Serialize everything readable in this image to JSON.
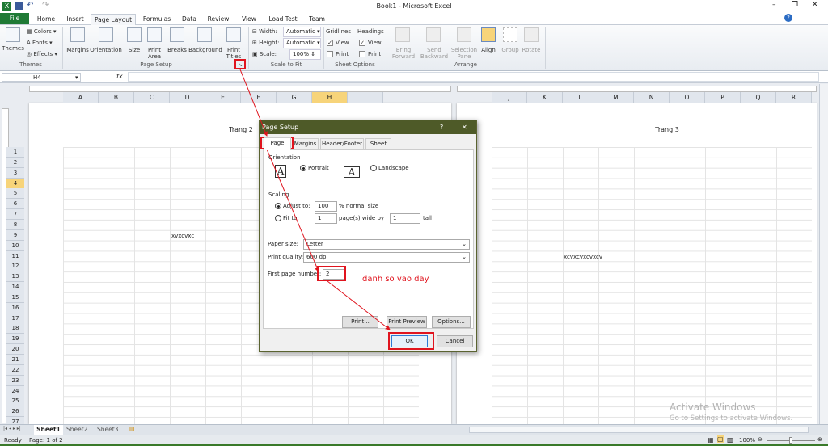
{
  "window": {
    "title": "Book1 - Microsoft Excel"
  },
  "ribbon_tabs": [
    "File",
    "Home",
    "Insert",
    "Page Layout",
    "Formulas",
    "Data",
    "Review",
    "View",
    "Load Test",
    "Team"
  ],
  "active_tab": "Page Layout",
  "ribbon": {
    "themes": {
      "themes": "Themes",
      "colors": "Colors",
      "fonts": "Fonts",
      "effects": "Effects",
      "group": "Themes"
    },
    "page_setup": {
      "margins": "Margins",
      "orientation": "Orientation",
      "size": "Size",
      "print_area_1": "Print",
      "print_area_2": "Area",
      "breaks": "Breaks",
      "background": "Background",
      "print_titles_1": "Print",
      "print_titles_2": "Titles",
      "group": "Page Setup"
    },
    "scale": {
      "width_label": "Width:",
      "width_value": "Automatic",
      "height_label": "Height:",
      "height_value": "Automatic",
      "scale_label": "Scale:",
      "scale_value": "100%",
      "group": "Scale to Fit"
    },
    "sheet_options": {
      "gridlines": "Gridlines",
      "headings": "Headings",
      "view": "View",
      "print": "Print",
      "group": "Sheet Options",
      "gridlines_view": true,
      "gridlines_print": false,
      "headings_view": true,
      "headings_print": false
    },
    "arrange": {
      "bring_1": "Bring",
      "bring_2": "Forward",
      "send_1": "Send",
      "send_2": "Backward",
      "selection_1": "Selection",
      "selection_2": "Pane",
      "align": "Align",
      "group_btn": "Group",
      "rotate": "Rotate",
      "group": "Arrange"
    }
  },
  "formula_bar": {
    "name_box": "H4",
    "fx": "fx",
    "value": ""
  },
  "columns_left": [
    "A",
    "B",
    "C",
    "D",
    "E",
    "F",
    "G",
    "H",
    "I"
  ],
  "columns_right": [
    "J",
    "K",
    "L",
    "M",
    "N",
    "O",
    "P",
    "Q",
    "R"
  ],
  "selected_column": "H",
  "rows": [
    "1",
    "2",
    "3",
    "4",
    "5",
    "6",
    "7",
    "8",
    "9",
    "10",
    "11",
    "12",
    "13",
    "14",
    "15",
    "16",
    "17",
    "18",
    "19",
    "20",
    "21",
    "22",
    "23",
    "24",
    "25",
    "26",
    "27"
  ],
  "selected_row": "4",
  "pages": [
    {
      "header": "Trang 2",
      "cell_text": "xvxcvxc"
    },
    {
      "header": "Trang 3",
      "cell_text": "xcvxcvxcvxcv"
    }
  ],
  "dialog": {
    "title": "Page Setup",
    "help": "?",
    "close": "✕",
    "tabs": [
      "Page",
      "Margins",
      "Header/Footer",
      "Sheet"
    ],
    "orientation_label": "Orientation",
    "portrait": "Portrait",
    "landscape": "Landscape",
    "orientation_selected": "Portrait",
    "scaling_label": "Scaling",
    "adjust_to": "Adjust to:",
    "adjust_value": "100",
    "normal_size": "% normal size",
    "fit_to": "Fit to:",
    "fit_wide": "1",
    "pages_wide_by": "page(s) wide by",
    "fit_tall": "1",
    "tall": "tall",
    "scaling_selected": "Adjust to",
    "paper_size_label": "Paper size:",
    "paper_size": "Letter",
    "print_quality_label": "Print quality:",
    "print_quality": "600 dpi",
    "first_page_label": "First page number:",
    "first_page": "2",
    "print": "Print...",
    "print_preview": "Print Preview",
    "options": "Options...",
    "ok": "OK",
    "cancel": "Cancel"
  },
  "annotation": {
    "text": "danh so vao day",
    "color": "#e0141e"
  },
  "sheets": [
    "Sheet1",
    "Sheet2",
    "Sheet3"
  ],
  "active_sheet": "Sheet1",
  "status": {
    "ready": "Ready",
    "page": "Page: 1 of 2",
    "zoom": "100%"
  },
  "watermark": {
    "line1": "Activate Windows",
    "line2": "Go to Settings to activate Windows."
  },
  "colors": {
    "file_tab": "#1f7a35",
    "dialog_title": "#4e5a28",
    "selection": "#f7d47a",
    "highlight": "#e0141e"
  }
}
